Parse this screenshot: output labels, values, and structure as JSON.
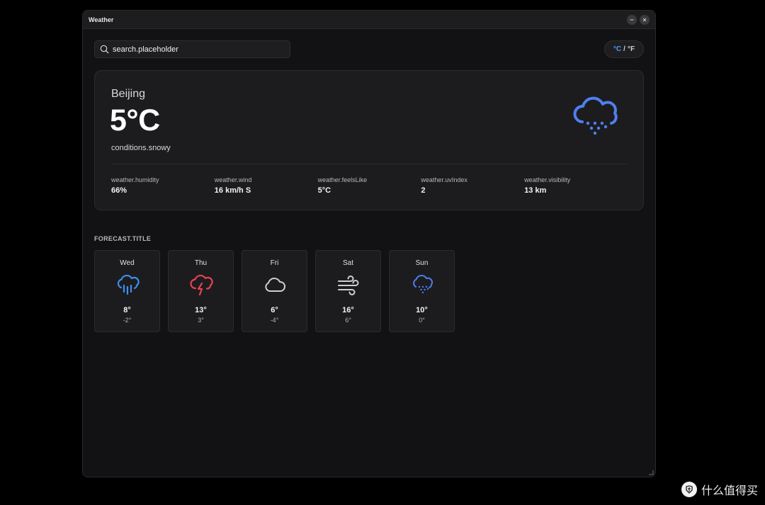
{
  "window": {
    "title": "Weather"
  },
  "search": {
    "placeholder": "search.placeholder",
    "value": ""
  },
  "unit_toggle": {
    "celsius": "°C",
    "separator": "/",
    "fahrenheit": "°F",
    "active": "celsius"
  },
  "current": {
    "city": "Beijing",
    "temperature": "5°C",
    "condition": "conditions.snowy",
    "icon": "snow-cloud-icon",
    "stats": [
      {
        "label": "weather.humidity",
        "value": "66%"
      },
      {
        "label": "weather.wind",
        "value": "16 km/h S"
      },
      {
        "label": "weather.feelsLike",
        "value": "5°C"
      },
      {
        "label": "weather.uvIndex",
        "value": "2"
      },
      {
        "label": "weather.visibility",
        "value": "13 km"
      }
    ]
  },
  "forecast": {
    "title": "FORECAST.TITLE",
    "days": [
      {
        "day": "Wed",
        "high": "8°",
        "low": "-2°",
        "icon": "rain-cloud-icon"
      },
      {
        "day": "Thu",
        "high": "13°",
        "low": "3°",
        "icon": "thunderstorm-cloud-icon"
      },
      {
        "day": "Fri",
        "high": "6°",
        "low": "-4°",
        "icon": "cloud-icon"
      },
      {
        "day": "Sat",
        "high": "16°",
        "low": "6°",
        "icon": "wind-icon"
      },
      {
        "day": "Sun",
        "high": "10°",
        "low": "0°",
        "icon": "snow-cloud-icon"
      }
    ]
  },
  "colors": {
    "accent": "#4a9cf2",
    "snow_icon": "#4f7ff0",
    "rain_icon": "#3d8ff0",
    "thunder_icon": "#e8424c",
    "cloud_icon": "#cfcfd2",
    "background": "#121214",
    "card": "#1c1c1f"
  },
  "watermark": {
    "text": "什么值得买",
    "logo_glyph": "值"
  }
}
